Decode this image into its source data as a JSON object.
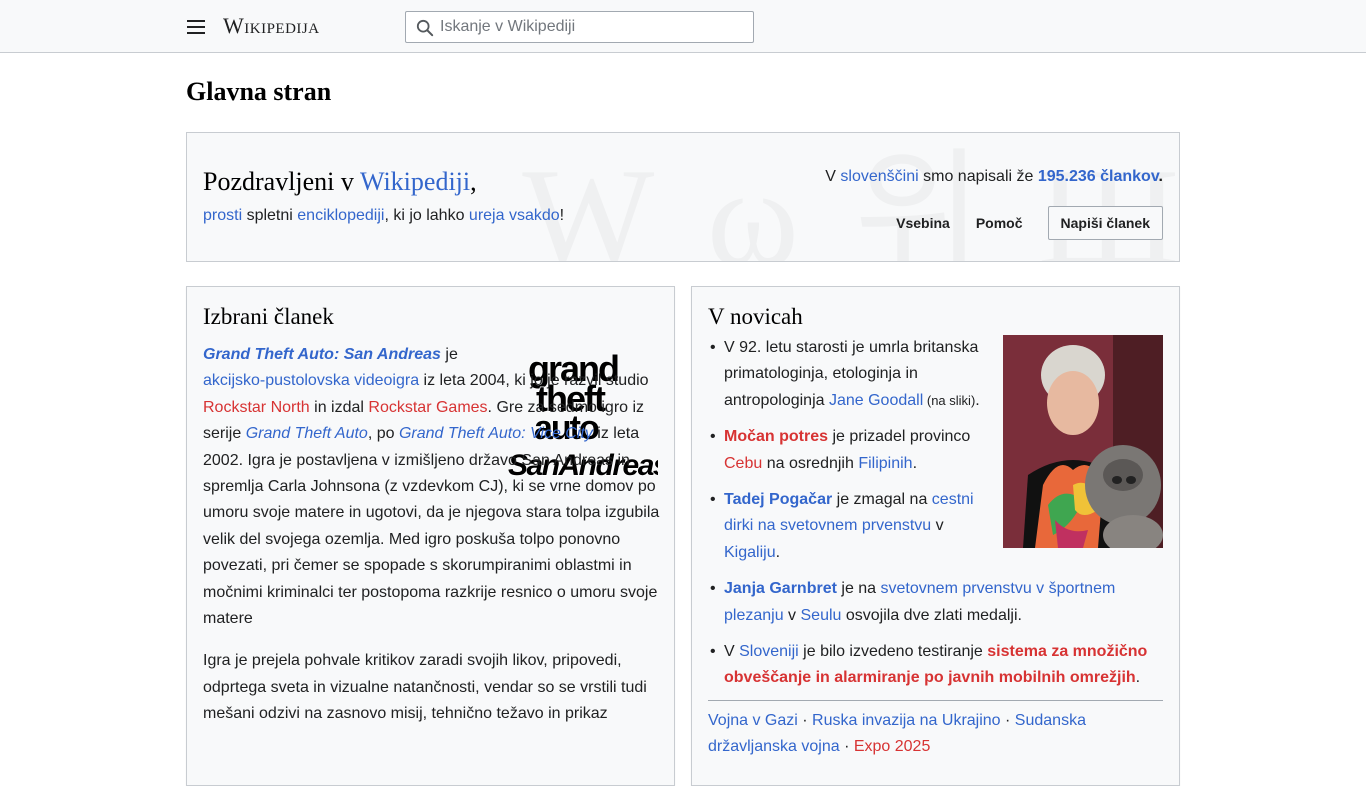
{
  "header": {
    "logo": "Wikipedija",
    "search_placeholder": "Iskanje v Wikipediji"
  },
  "page_title": "Glavna stran",
  "welcome": {
    "greeting": "Pozdravljeni v ",
    "greeting_link": "Wikipediji",
    "greeting_end": ",",
    "sub": {
      "link1": "prosti",
      "t1": " spletni ",
      "link2": "enciklopediji",
      "t2": ", ki jo lahko ",
      "link3": "ureja vsakdo",
      "t3": "!"
    },
    "stat": {
      "t1": "V ",
      "link1": "slovenščini",
      "t2": " smo napisali že ",
      "count": "195.236 člankov",
      "t3": "."
    },
    "actions": {
      "contents": "Vsebina",
      "help": "Pomoč",
      "write": "Napiši članek"
    }
  },
  "featured": {
    "title": "Izbrani članek",
    "p1": {
      "title_link": "Grand Theft Auto: San Andreas",
      "a": " je ",
      "genre_link": "akcijsko-pustolovska videoigra",
      "b": " iz leta 2004, ki jo je razvil studio ",
      "dev_link": "Rockstar North",
      "c": " in izdal ",
      "pub_link": "Rockstar Games",
      "d": ". Gre za sedmo igro iz serije ",
      "series_link": "Grand Theft Auto",
      "e": ", po ",
      "prev_link": "Grand Theft Auto: Vice City",
      "f": " iz leta 2002. Igra je postavljena v izmišljeno državo San Andreas in spremlja Carla Johnsona (z vzdevkom CJ), ki se vrne domov po umoru svoje matere in ugotovi, da je njegova stara tolpa izgubila velik del svojega ozemlja. Med igro poskuša tolpo ponovno povezati, pri čemer se spopade s skorumpiranimi oblastmi in močnimi kriminalci ter postopoma razkrije resnico o umoru svoje matere"
    },
    "p2": "Igra je prejela pohvale kritikov zaradi svojih likov, pripovedi, odprtega sveta in vizualne natančnosti, vendar so se vrstili tudi mešani odzivi na zasnovo misij, tehnično težavo in prikaz",
    "logo_words": [
      "grand",
      "theft",
      "auto",
      "SanAndreas"
    ]
  },
  "news": {
    "title": "V novicah",
    "items": [
      {
        "a": "V 92. letu starosti je umrla britanska primatologinja, etologinja in antropologinja ",
        "link": "Jane Goodall",
        "note": " (na sliki)",
        "end": "."
      },
      {
        "link1": "Močan potres",
        "a": " je prizadel provinco ",
        "link2": "Cebu",
        "b": " na osrednjih ",
        "link3": "Filipinih",
        "end": "."
      },
      {
        "link1": "Tadej Pogačar",
        "a": " je zmagal na ",
        "link2": "cestni dirki na svetovnem prvenstvu",
        "b": " v ",
        "link3": "Kigaliju",
        "end": "."
      },
      {
        "link1": "Janja Garnbret",
        "a": " je na ",
        "link2": "svetovnem prvenstvu v športnem plezanju",
        "b": " v ",
        "link3": "Seulu",
        "end": " osvojila dve zlati medalji."
      },
      {
        "a": "V ",
        "link1": "Sloveniji",
        "b": " je bilo izvedeno testiranje ",
        "link2": "sistema za množično obveščanje in alarmiranje po javnih mobilnih omrežjih",
        "end": "."
      }
    ],
    "ongoing": [
      "Vojna v Gazi",
      "Ruska invazija na Ukrajino",
      "Sudanska državljanska vojna",
      "Expo 2025"
    ],
    "sep": " · "
  },
  "colors": {
    "link": "#3366cc",
    "redlink": "#d73333",
    "box_bg": "#f8f9fa",
    "border": "#c8ccd1"
  }
}
